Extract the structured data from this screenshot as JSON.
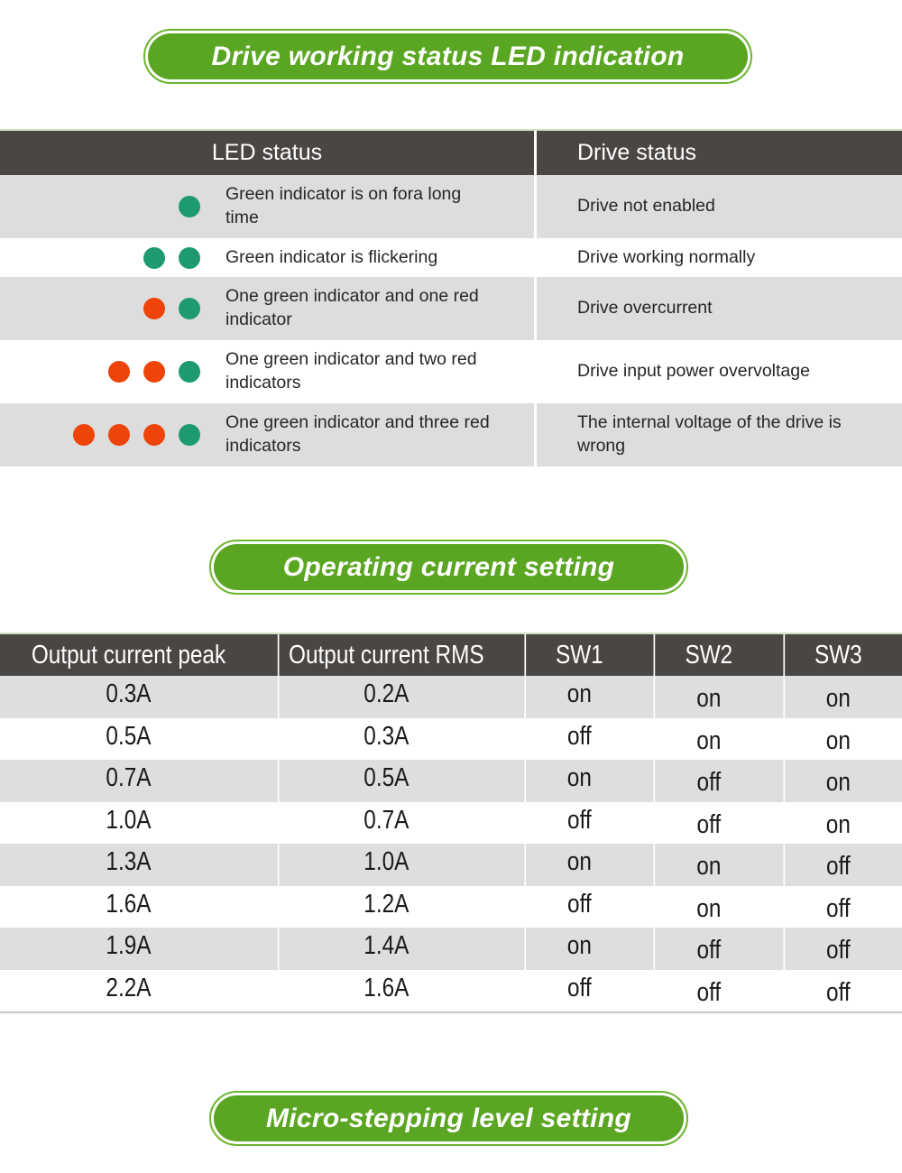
{
  "banners": {
    "led_indication": "Drive working status LED indication",
    "operating_current": "Operating current setting",
    "micro_stepping": "Micro-stepping level setting"
  },
  "colors": {
    "banner_fill": "#5aa521",
    "banner_border": "#6cb52d",
    "header_bar": "#4a4644",
    "row_alt": "#dddddd",
    "led_green": "#1e9a72",
    "led_red": "#ee4409"
  },
  "led_table": {
    "headers": {
      "led_status": "LED status",
      "drive_status": "Drive status"
    },
    "rows": [
      {
        "leds": [
          "green"
        ],
        "led_label": "Green indicator is on fora long time",
        "drive_status": "Drive not enabled"
      },
      {
        "leds": [
          "green",
          "green"
        ],
        "led_label": "Green indicator is flickering",
        "drive_status": "Drive working normally"
      },
      {
        "leds": [
          "red",
          "green"
        ],
        "led_label": "One green indicator and one red indicator",
        "drive_status": "Drive overcurrent"
      },
      {
        "leds": [
          "red",
          "red",
          "green"
        ],
        "led_label": "One green indicator and two red indicators",
        "drive_status": "Drive input power overvoltage"
      },
      {
        "leds": [
          "red",
          "red",
          "red",
          "green"
        ],
        "led_label": "One green indicator and three red indicators",
        "drive_status": "The internal voltage of the drive is wrong"
      }
    ]
  },
  "current_table": {
    "headers": [
      "Output current peak",
      "Output current RMS",
      "SW1",
      "SW2",
      "SW3"
    ],
    "rows": [
      {
        "peak": "0.3A",
        "rms": "0.2A",
        "sw1": "on",
        "sw2": "on",
        "sw3": "on"
      },
      {
        "peak": "0.5A",
        "rms": "0.3A",
        "sw1": "off",
        "sw2": "on",
        "sw3": "on"
      },
      {
        "peak": "0.7A",
        "rms": "0.5A",
        "sw1": "on",
        "sw2": "off",
        "sw3": "on"
      },
      {
        "peak": "1.0A",
        "rms": "0.7A",
        "sw1": "off",
        "sw2": "off",
        "sw3": "on"
      },
      {
        "peak": "1.3A",
        "rms": "1.0A",
        "sw1": "on",
        "sw2": "on",
        "sw3": "off"
      },
      {
        "peak": "1.6A",
        "rms": "1.2A",
        "sw1": "off",
        "sw2": "on",
        "sw3": "off"
      },
      {
        "peak": "1.9A",
        "rms": "1.4A",
        "sw1": "on",
        "sw2": "off",
        "sw3": "off"
      },
      {
        "peak": "2.2A",
        "rms": "1.6A",
        "sw1": "off",
        "sw2": "off",
        "sw3": "off"
      }
    ]
  }
}
